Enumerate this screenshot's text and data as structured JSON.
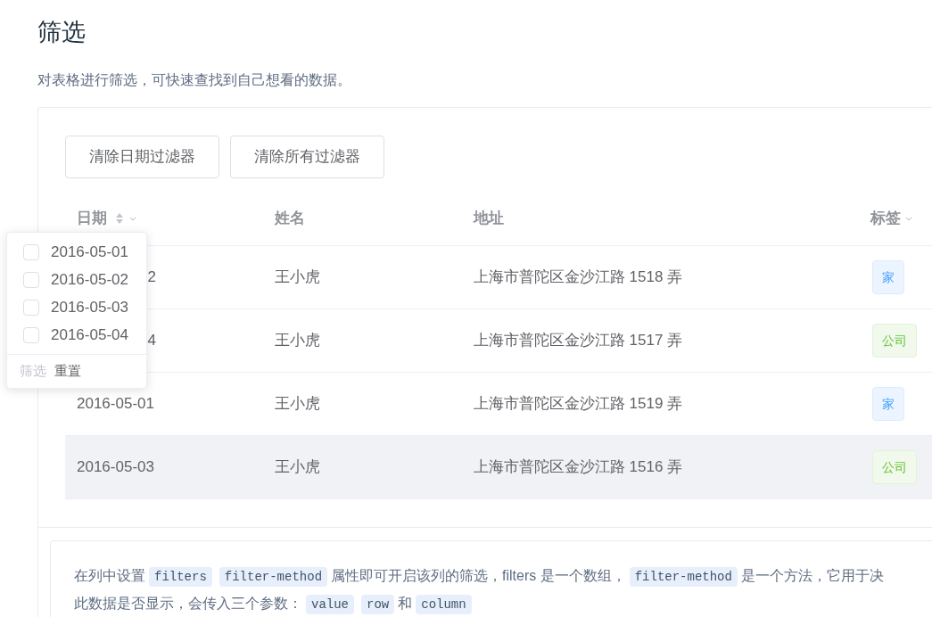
{
  "title": "筛选",
  "description": "对表格进行筛选，可快速查找到自己想看的数据。",
  "buttons": [
    "清除日期过滤器",
    "清除所有过滤器"
  ],
  "table": {
    "columns": [
      {
        "label": "日期",
        "sortable": true,
        "filterable": true
      },
      {
        "label": "姓名",
        "sortable": false,
        "filterable": false
      },
      {
        "label": "地址",
        "sortable": false,
        "filterable": false
      },
      {
        "label": "标签",
        "sortable": false,
        "filterable": true
      }
    ],
    "rows": [
      {
        "date": "2",
        "date_covered": true,
        "name": "王小虎",
        "address": "上海市普陀区金沙江路 1518 弄",
        "tag": {
          "label": "家",
          "kind": "home"
        },
        "hovered": false
      },
      {
        "date": "4",
        "date_covered": true,
        "name": "王小虎",
        "address": "上海市普陀区金沙江路 1517 弄",
        "tag": {
          "label": "公司",
          "kind": "company"
        },
        "hovered": false
      },
      {
        "date": "2016-05-01",
        "date_covered": false,
        "name": "王小虎",
        "address": "上海市普陀区金沙江路 1519 弄",
        "tag": {
          "label": "家",
          "kind": "home"
        },
        "hovered": false
      },
      {
        "date": "2016-05-03",
        "date_covered": false,
        "name": "王小虎",
        "address": "上海市普陀区金沙江路 1516 弄",
        "tag": {
          "label": "公司",
          "kind": "company"
        },
        "hovered": true
      }
    ]
  },
  "filter_popup": {
    "options": [
      {
        "label": "2016-05-01",
        "checked": false
      },
      {
        "label": "2016-05-02",
        "checked": false
      },
      {
        "label": "2016-05-03",
        "checked": false
      },
      {
        "label": "2016-05-04",
        "checked": false
      }
    ],
    "confirm": {
      "label": "筛选",
      "disabled": true
    },
    "reset": {
      "label": "重置",
      "disabled": false
    }
  },
  "notes": [
    [
      {
        "kind": "text",
        "text": "在列中设置"
      },
      {
        "kind": "code",
        "text": "filters"
      },
      {
        "kind": "code",
        "text": "filter-method"
      },
      {
        "kind": "text",
        "text": "属性即可开启该列的筛选，filters 是一个数组，"
      },
      {
        "kind": "code",
        "text": "filter-method"
      },
      {
        "kind": "text",
        "text": "是一个方法，它用于决"
      }
    ],
    [
      {
        "kind": "text",
        "text": "此数据是否显示，会传入三个参数："
      },
      {
        "kind": "code",
        "text": "value"
      },
      {
        "kind": "code",
        "text": "row"
      },
      {
        "kind": "text",
        "text": "和"
      },
      {
        "kind": "code",
        "text": "column"
      }
    ]
  ]
}
